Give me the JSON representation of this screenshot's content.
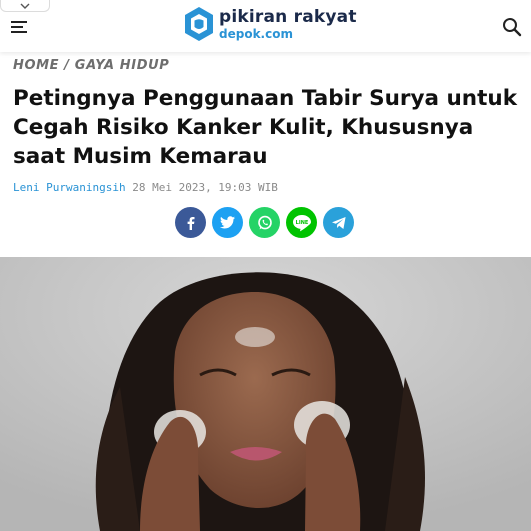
{
  "site": {
    "name": "pikiran rakyat",
    "subdomain": "depok.com",
    "brand_color": "#2a93d5",
    "dark_color": "#1b2a4a"
  },
  "header": {
    "icons": [
      "chevron-down-icon",
      "menu-icon",
      "search-icon"
    ]
  },
  "breadcrumb": {
    "home": "HOME",
    "separator": "/",
    "section": "GAYA HIDUP"
  },
  "article": {
    "title": "Petingnya Penggunaan Tabir Surya untuk Cegah Risiko Kanker Kulit, Khususnya saat Musim Kemarau",
    "author": "Leni Purwaningsih",
    "date": "28 Mei 2023, 19:03 WIB"
  },
  "share": [
    {
      "network": "facebook",
      "color": "#3b5998"
    },
    {
      "network": "twitter",
      "color": "#1da1f2"
    },
    {
      "network": "whatsapp",
      "color": "#25d366"
    },
    {
      "network": "line",
      "color": "#00c300"
    },
    {
      "network": "telegram",
      "color": "#2aa1da"
    }
  ]
}
